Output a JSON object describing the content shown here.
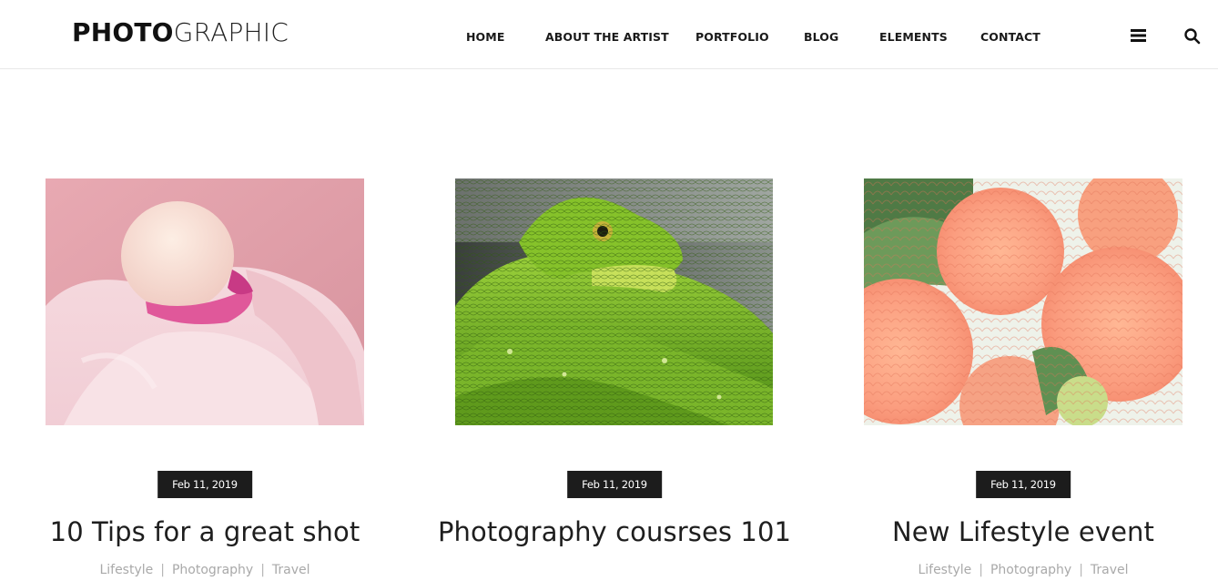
{
  "logo": {
    "bold": "PHOTO",
    "light": "GRAPHIC"
  },
  "nav": [
    {
      "label": "HOME"
    },
    {
      "label": "ABOUT THE ARTIST"
    },
    {
      "label": "PORTFOLIO"
    },
    {
      "label": "BLOG"
    },
    {
      "label": "ELEMENTS"
    },
    {
      "label": "CONTACT"
    }
  ],
  "header_icons": {
    "menu": "hamburger-menu-icon",
    "search": "search-icon"
  },
  "posts": [
    {
      "image": "flamingo-photo",
      "date": "Feb 11, 2019",
      "title": "10 Tips for a great shot",
      "tags": [
        "Lifestyle",
        "Photography",
        "Travel"
      ]
    },
    {
      "image": "green-snake-photo",
      "date": "Feb 11, 2019",
      "title": "Photography cousrses 101",
      "tags": []
    },
    {
      "image": "peach-dahlias-photo",
      "date": "Feb 11, 2019",
      "title": "New Lifestyle event",
      "tags": [
        "Lifestyle",
        "Photography",
        "Travel"
      ]
    }
  ],
  "tag_separator": "|"
}
